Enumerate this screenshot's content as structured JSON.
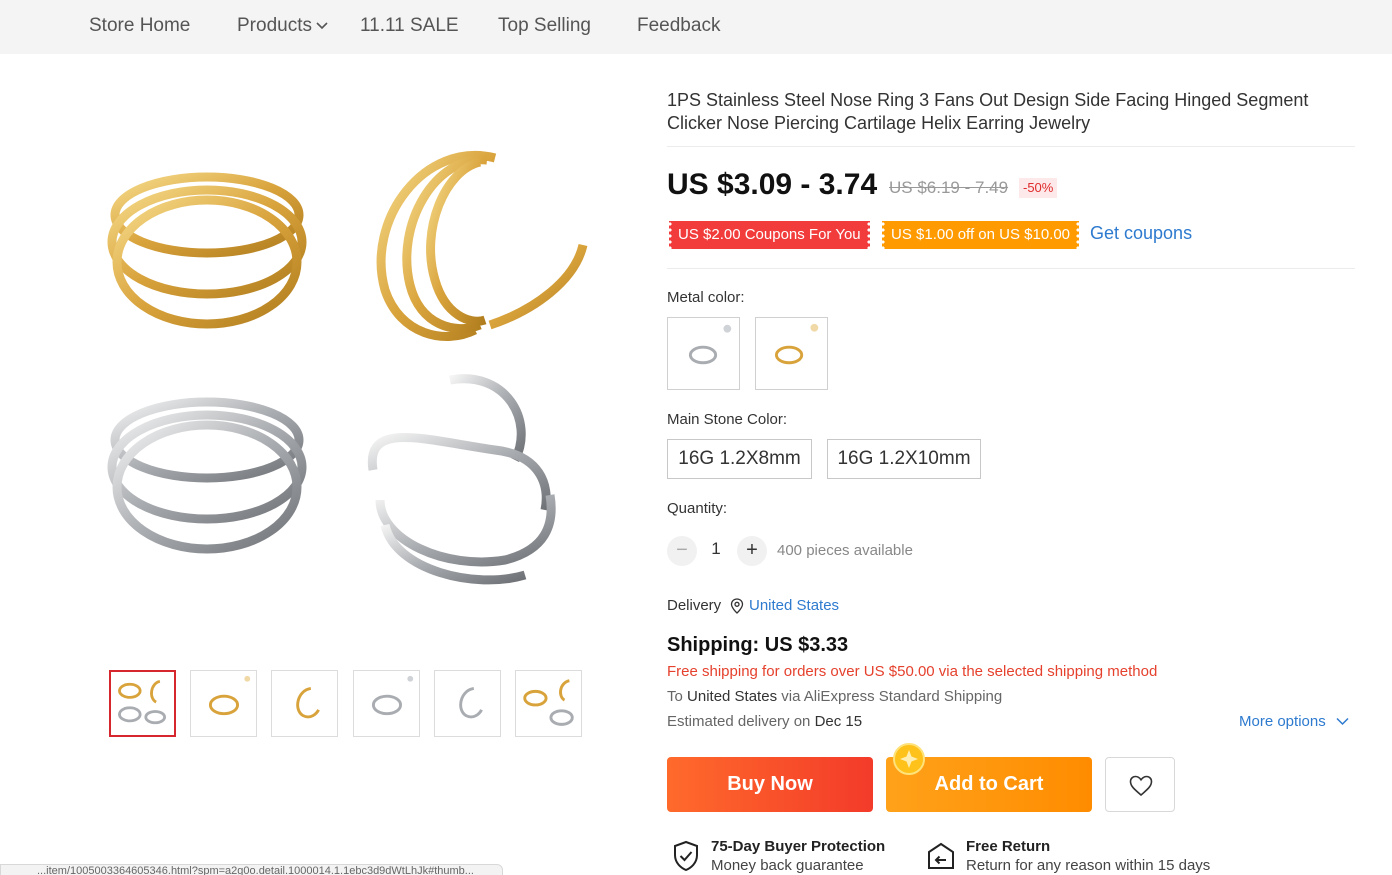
{
  "nav": {
    "items": [
      {
        "label": "Store Home"
      },
      {
        "label": "Products"
      },
      {
        "label": "11.11 SALE"
      },
      {
        "label": "Top Selling"
      },
      {
        "label": "Feedback"
      }
    ]
  },
  "product": {
    "title": "1PS Stainless Steel Nose Ring 3 Fans Out Design Side Facing Hinged Segment Clicker Nose Piercing Cartilage Helix Earring Jewelry",
    "price": "US $3.09 - 3.74",
    "original_price": "US $6.19 - 7.49",
    "discount": "-50%",
    "coupons": [
      {
        "label": "US $2.00 Coupons For You"
      },
      {
        "label": "US $1.00 off on US $10.00"
      }
    ],
    "get_coupons_label": "Get coupons",
    "metal_color_label": "Metal color:",
    "main_stone_color_label": "Main Stone Color:",
    "stone_options": [
      "16G 1.2X8mm",
      "16G 1.2X10mm"
    ],
    "quantity_label": "Quantity:",
    "quantity": "1",
    "quantity_minus": "−",
    "quantity_plus": "+",
    "available": "400 pieces available"
  },
  "delivery": {
    "label": "Delivery",
    "country": "United States",
    "shipping": "Shipping: US $3.33",
    "free_shipping_note": "Free shipping for orders over US $50.00 via the selected shipping method",
    "route_prefix": "To ",
    "route_country": "United States",
    "route_mid": " via ",
    "route_method": "AliExpress Standard Shipping",
    "estimate_prefix": "Estimated delivery on ",
    "estimate_date": "Dec 15",
    "more_options": "More options"
  },
  "actions": {
    "buy_now": "Buy Now",
    "add_to_cart": "Add to Cart"
  },
  "guarantees": [
    {
      "title": "75-Day Buyer Protection",
      "subtitle": "Money back guarantee"
    },
    {
      "title": "Free Return",
      "subtitle": "Return for any reason within 15 days"
    }
  ],
  "statusbar": {
    "url": "...item/1005003364605346.html?spm=a2g0o.detail.1000014.1.1ebc3d9dWtLhJk#thumb..."
  },
  "colors": {
    "gold": "#e0b24d",
    "silver": "#b9bcc0",
    "accent_red": "#e02c2c",
    "link_blue": "#2d7acf"
  }
}
